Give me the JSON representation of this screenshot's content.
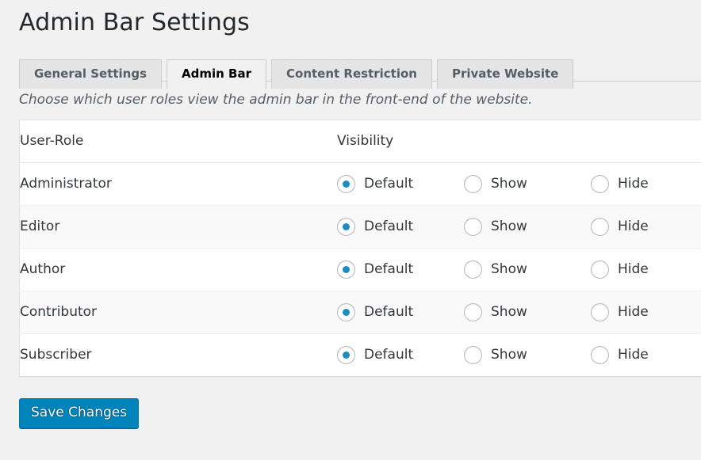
{
  "page": {
    "title": "Admin Bar Settings",
    "description": "Choose which user roles view the admin bar in the front-end of the website."
  },
  "tabs": [
    {
      "label": "General Settings",
      "active": false
    },
    {
      "label": "Admin Bar",
      "active": true
    },
    {
      "label": "Content Restriction",
      "active": false
    },
    {
      "label": "Private Website",
      "active": false
    }
  ],
  "table": {
    "headers": {
      "role": "User-Role",
      "visibility": "Visibility"
    },
    "options": [
      "Default",
      "Show",
      "Hide"
    ],
    "rows": [
      {
        "role": "Administrator",
        "selected": "Default"
      },
      {
        "role": "Editor",
        "selected": "Default"
      },
      {
        "role": "Author",
        "selected": "Default"
      },
      {
        "role": "Contributor",
        "selected": "Default"
      },
      {
        "role": "Subscriber",
        "selected": "Default"
      }
    ]
  },
  "actions": {
    "save_label": "Save Changes"
  },
  "colors": {
    "accent": "#1e8cbe",
    "button": "#0085ba",
    "button_border": "#0073aa",
    "page_background": "#f1f1f1",
    "tab_inactive": "#e5e5e5"
  }
}
